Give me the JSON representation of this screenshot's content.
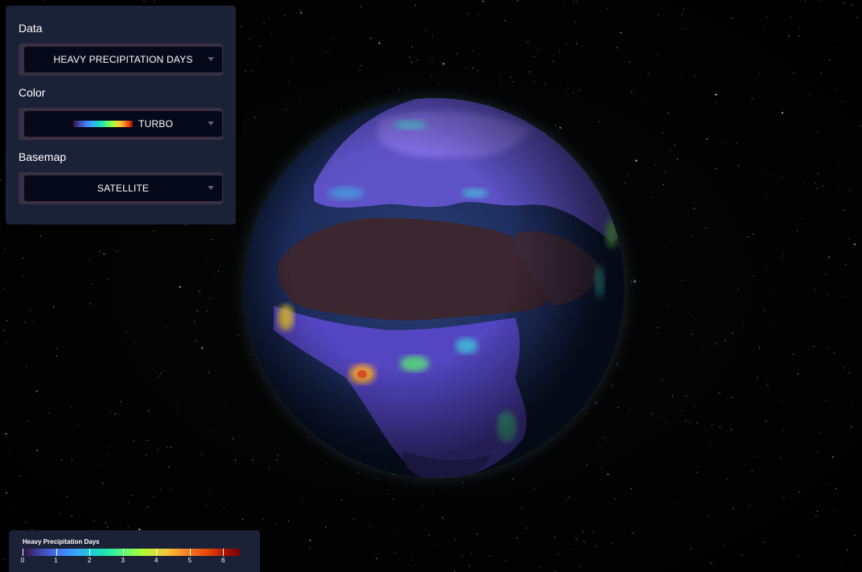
{
  "controls": {
    "data": {
      "label": "Data",
      "value": "HEAVY PRECIPITATION DAYS"
    },
    "color": {
      "label": "Color",
      "value": "TURBO"
    },
    "basemap": {
      "label": "Basemap",
      "value": "SATELLITE"
    }
  },
  "legend": {
    "title": "Heavy Precipitation Days",
    "ticks": [
      "0",
      "1",
      "2",
      "3",
      "4",
      "5",
      "6"
    ],
    "range": [
      0,
      6.5
    ],
    "colormap": "turbo"
  },
  "colors": {
    "panel": "#1b2237",
    "select_border": "#3b2f45",
    "select_bg": "#06091a",
    "text": "#ffffff"
  },
  "icons": [
    "chevron-down-icon"
  ]
}
